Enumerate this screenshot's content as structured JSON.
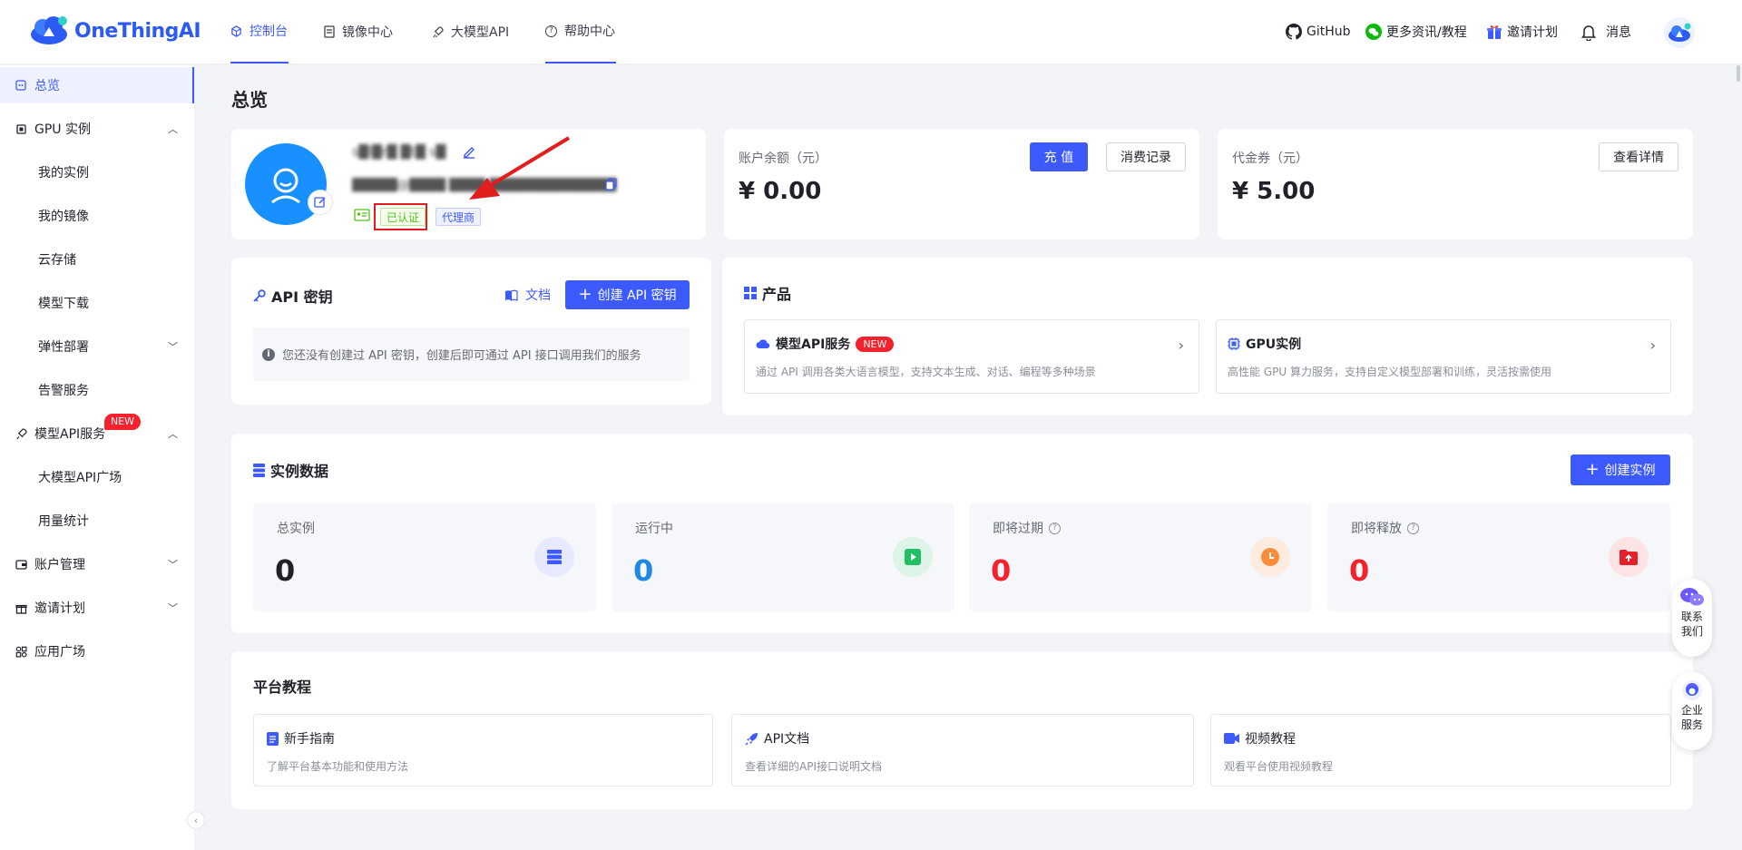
{
  "brand": {
    "name": "OneThingAI"
  },
  "nav": {
    "tabs": [
      {
        "label": "控制台"
      },
      {
        "label": "镜像中心"
      },
      {
        "label": "大模型API"
      },
      {
        "label": "帮助中心"
      }
    ],
    "right": {
      "github": "GitHub",
      "news": "更多资讯/教程",
      "invite": "邀请计划",
      "messages": "消息"
    }
  },
  "sidebar": {
    "overview": "总览",
    "gpu": "GPU 实例",
    "my_instances": "我的实例",
    "my_images": "我的镜像",
    "cloud_storage": "云存储",
    "model_download": "模型下载",
    "elastic_deploy": "弹性部署",
    "alert_service": "告警服务",
    "model_api": "模型API服务",
    "model_api_badge": "NEW",
    "llm_square": "大模型API广场",
    "usage_stats": "用量统计",
    "account": "账户管理",
    "invite": "邀请计划",
    "app_square": "应用广场"
  },
  "page": {
    "title": "总览"
  },
  "profile": {
    "name": "s█l█r█ █t█ s█",
    "email": "█████@████ ████ ██████████████",
    "verified": "已认证",
    "agent": "代理商"
  },
  "balance": {
    "label": "账户余额（元）",
    "value": "¥ 0.00",
    "recharge": "充 值",
    "history": "消费记录"
  },
  "voucher": {
    "label": "代金券（元）",
    "value": "¥ 5.00",
    "details": "查看详情"
  },
  "api_key": {
    "title": "API 密钥",
    "docs": "文档",
    "create": "创建 API 密钥",
    "notice": "您还没有创建过 API 密钥，创建后即可通过 API 接口调用我们的服务"
  },
  "products": {
    "title": "产品",
    "items": [
      {
        "name": "模型API服务",
        "badge": "NEW",
        "desc": "通过 API 调用各类大语言模型，支持文本生成、对话、编程等多种场景"
      },
      {
        "name": "GPU实例",
        "desc": "高性能 GPU 算力服务，支持自定义模型部署和训练，灵活按需使用"
      }
    ]
  },
  "instances": {
    "title": "实例数据",
    "create": "创建实例",
    "stats": [
      {
        "label": "总实例",
        "value": "0",
        "color": "#1f2329",
        "icon": "server-icon"
      },
      {
        "label": "运行中",
        "value": "0",
        "color": "#1e88e5",
        "icon": "play-icon"
      },
      {
        "label": "即将过期",
        "value": "0",
        "color": "#f5222d",
        "icon": "clock-icon"
      },
      {
        "label": "即将释放",
        "value": "0",
        "color": "#f5222d",
        "icon": "folder-upload-icon"
      }
    ]
  },
  "tutorials": {
    "title": "平台教程",
    "items": [
      {
        "name": "新手指南",
        "desc": "了解平台基本功能和使用方法"
      },
      {
        "name": "API文档",
        "desc": "查看详细的API接口说明文档"
      },
      {
        "name": "视频教程",
        "desc": "观看平台使用视频教程"
      }
    ]
  },
  "float": {
    "contact": "联系我们",
    "enterprise": "企业服务"
  },
  "colors": {
    "primary": "#3d5afe",
    "danger": "#f5222d",
    "success": "#52c41a",
    "blue": "#1e88e5"
  }
}
